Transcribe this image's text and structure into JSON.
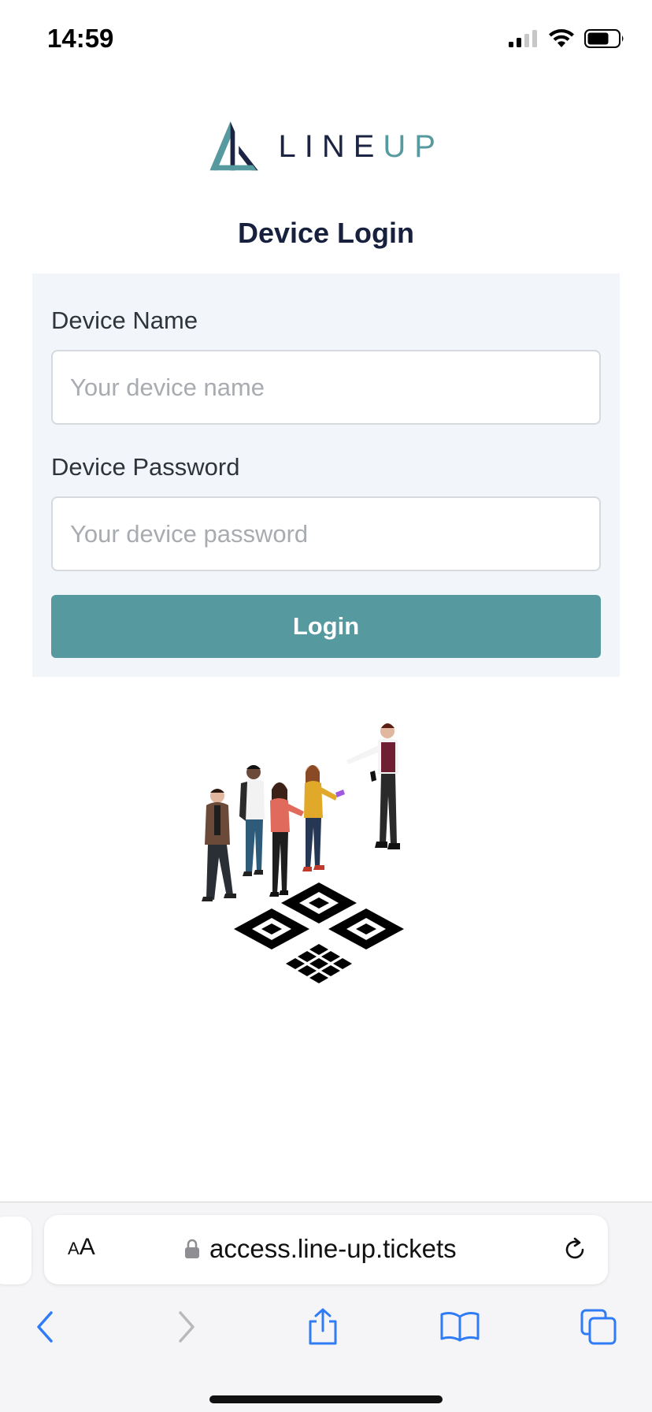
{
  "status_bar": {
    "time": "14:59"
  },
  "logo": {
    "text_line": "LINE",
    "text_up": "UP",
    "colors": {
      "dark": "#1c2443",
      "teal": "#569a9f"
    }
  },
  "page": {
    "title": "Device Login"
  },
  "form": {
    "device_name": {
      "label": "Device Name",
      "placeholder": "Your device name",
      "value": ""
    },
    "device_password": {
      "label": "Device Password",
      "placeholder": "Your device password",
      "value": ""
    },
    "login_label": "Login"
  },
  "illustration": {
    "icon": "queue-qr-code-illustration"
  },
  "browser": {
    "aa_small": "A",
    "aa_large": "A",
    "url": "access.line-up.tickets",
    "icons": [
      "text-size-icon",
      "lock-icon",
      "reload-icon",
      "back-icon",
      "forward-icon",
      "share-icon",
      "bookmarks-icon",
      "tabs-icon"
    ]
  },
  "theme": {
    "accent": "#569a9f",
    "panel_bg": "#f2f5fa",
    "title_color": "#17213d",
    "browser_blue": "#2f7cf6"
  }
}
